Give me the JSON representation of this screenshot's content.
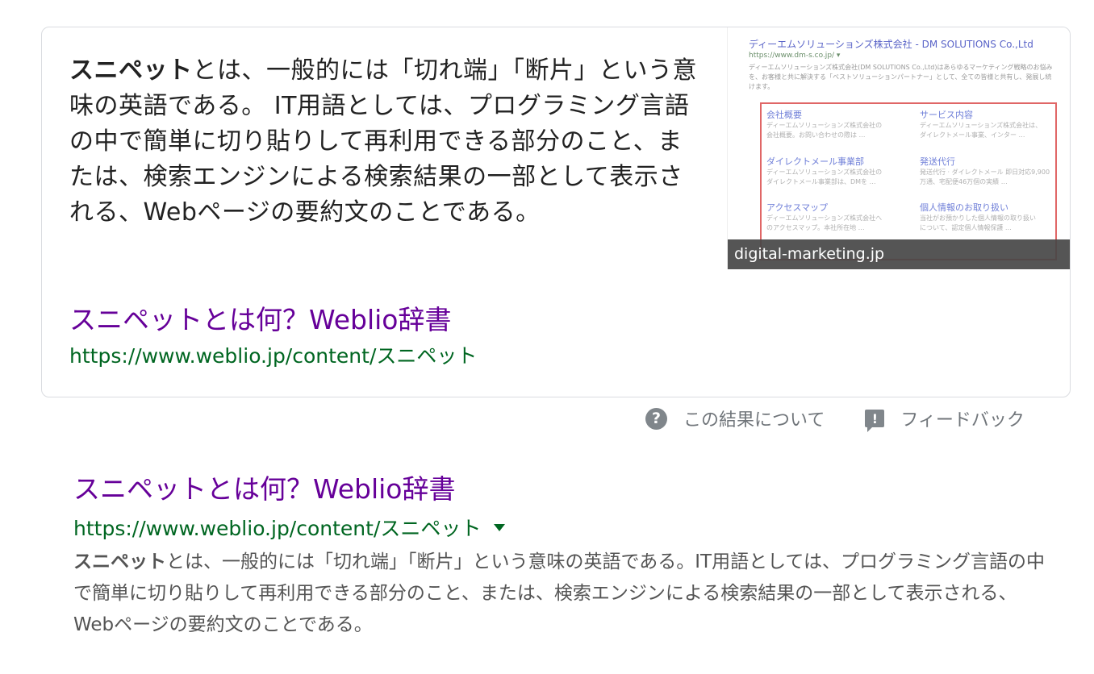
{
  "featured": {
    "snippet_bold": "スニペット",
    "snippet_text": "とは、一般的には「切れ端」「断片」という意味の英語である。 IT用語としては、プログラミング言語の中で簡単に切り貼りして再利用できる部分のこと、または、検索エンジンによる検索結果の一部として表示される、Webページの要約文のことである。",
    "link_title": "スニペットとは何？Weblio辞書",
    "url": "https://www.weblio.jp/content/スニペット",
    "thumbnail": {
      "caption": "digital-marketing.jp",
      "site_title": "ディーエムソリューションズ株式会社 - DM SOLUTIONS Co.,Ltd",
      "site_url": "https://www.dm-s.co.jp/ ▾",
      "site_desc": "ディーエムソリューションズ株式会社(DM SOLUTIONS Co.,Ltd)はあらゆるマーケティング戦略のお悩みを、お客様と共に解決する「ベストソリューションパートナー」として、全ての皆様と共有し、発展し続けます。",
      "sitelinks": [
        {
          "title": "会社概要",
          "desc1": "ディーエムソリューションズ株式会社の",
          "desc2": "会社概要。お問い合わせの際は …"
        },
        {
          "title": "サービス内容",
          "desc1": "ディーエムソリューションズ株式会社は、",
          "desc2": "ダイレクトメール事業、インター …"
        },
        {
          "title": "ダイレクトメール事業部",
          "desc1": "ディーエムソリューションズ株式会社の",
          "desc2": "ダイレクトメール事業部は、DMを …"
        },
        {
          "title": "発送代行",
          "desc1": "発送代行 · ダイレクトメール 即日対応9,900",
          "desc2": "万通、宅配便46万個の実績 …"
        },
        {
          "title": "アクセスマップ",
          "desc1": "ディーエムソリューションズ株式会社へ",
          "desc2": "のアクセスマップ。本社所在地 …"
        },
        {
          "title": "個人情報のお取り扱い",
          "desc1": "当社がお預かりした個人情報の取り扱い",
          "desc2": "について、認定個人情報保護 …"
        }
      ]
    }
  },
  "about_label": "この結果について",
  "feedback_label": "フィードバック",
  "about_icon": "help-circle-icon",
  "feedback_icon": "feedback-icon",
  "result": {
    "title": "スニペットとは何？Weblio辞書",
    "url": "https://www.weblio.jp/content/スニペット",
    "desc_bold": "スニペット",
    "desc_text": "とは、一般的には「切れ端」「断片」という意味の英語である。IT用語としては、プログラミング言語の中で簡単に切り貼りして再利用できる部分のこと、または、検索エンジンによる検索結果の一部として表示される、Webページの要約文のことである。"
  },
  "colors": {
    "link": "#660099",
    "url": "#006621",
    "text": "#222222",
    "muted": "#70757a"
  }
}
